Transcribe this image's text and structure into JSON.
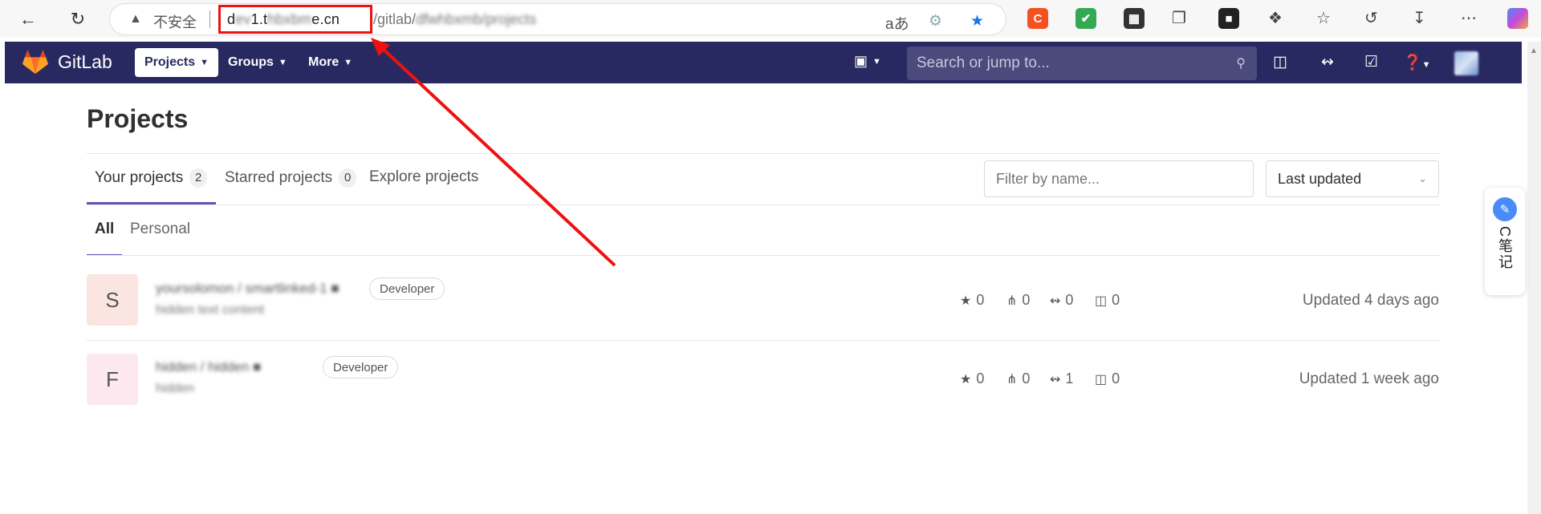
{
  "browser": {
    "insecure_label": "不安全",
    "url_host_prefix": "d",
    "url_host_mid": "1.t",
    "url_host_suffix": "e.cn",
    "url_path": "/gitlab/",
    "translate_icon": "aあ"
  },
  "nav": {
    "brand": "GitLab",
    "projects_label": "Projects",
    "groups_label": "Groups",
    "more_label": "More",
    "search_placeholder": "Search or jump to..."
  },
  "page": {
    "title": "Projects",
    "tabs": [
      {
        "label": "Your projects",
        "count": "2"
      },
      {
        "label": "Starred projects",
        "count": "0"
      },
      {
        "label": "Explore projects"
      }
    ],
    "filter_placeholder": "Filter by name...",
    "sort_label": "Last updated",
    "sub_tabs": [
      "All",
      "Personal"
    ]
  },
  "projects": [
    {
      "initial": "S",
      "avatar_color": "#fbe5e1",
      "role": "Developer",
      "stars": "0",
      "forks": "0",
      "merge_requests": "0",
      "issues": "0",
      "updated": "Updated 4 days ago"
    },
    {
      "initial": "F",
      "avatar_color": "#fce8ee",
      "role": "Developer",
      "stars": "0",
      "forks": "0",
      "merge_requests": "1",
      "issues": "0",
      "updated": "Updated 1 week ago"
    }
  ],
  "side_widget": {
    "label": "C笔记"
  },
  "colors": {
    "nav_bg": "#292961",
    "accent": "#6b4fbb",
    "annotation": "#ee1111"
  }
}
